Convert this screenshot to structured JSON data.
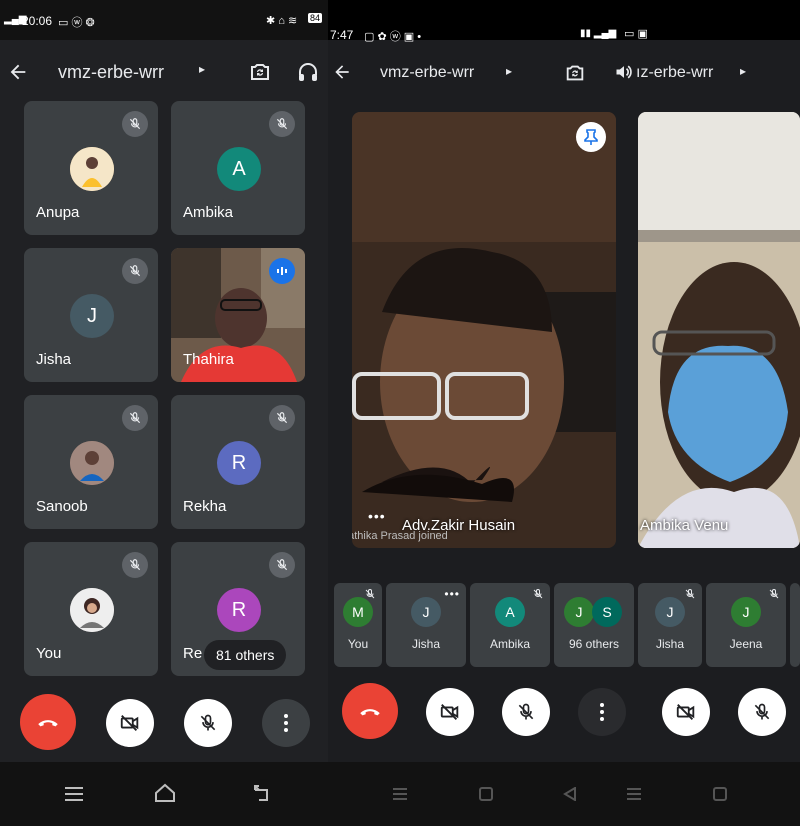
{
  "left": {
    "status": {
      "time": "20:06",
      "battery": "84"
    },
    "meeting_code": "vmz-erbe-wrr",
    "participants": [
      {
        "name": "Anupa",
        "initial": "",
        "color": "#f1c27d",
        "muted": true,
        "kind": "photo"
      },
      {
        "name": "Ambika",
        "initial": "A",
        "color": "#12897a",
        "muted": true,
        "kind": "letter"
      },
      {
        "name": "Jisha",
        "initial": "J",
        "color": "#455a64",
        "muted": true,
        "kind": "letter"
      },
      {
        "name": "Thahira",
        "initial": "",
        "color": "",
        "muted": false,
        "kind": "video"
      },
      {
        "name": "Sanoob",
        "initial": "",
        "color": "#8d6e63",
        "muted": true,
        "kind": "photo"
      },
      {
        "name": "Rekha",
        "initial": "R",
        "color": "#5c6bc0",
        "muted": true,
        "kind": "letter"
      },
      {
        "name": "You",
        "initial": "",
        "color": "#d7ccc8",
        "muted": true,
        "kind": "photo"
      },
      {
        "name": "Re",
        "initial": "R",
        "color": "#ab47bc",
        "muted": true,
        "kind": "letter"
      }
    ],
    "others_label": "81 others"
  },
  "right": {
    "status": {
      "time": "7:47"
    },
    "meeting_code": "vmz-erbe-wrr",
    "meeting_code_partial": "ız-erbe-wrr",
    "speaker_main": "Adv.Zakir Husain",
    "join_toast": "Lathika Prasad joined",
    "speaker_second": "Ambika Venu",
    "strip": [
      {
        "name": "You",
        "initial": "M",
        "color": "#2e7d32",
        "muted": true
      },
      {
        "name": "Jisha",
        "initial": "J",
        "color": "#455a64",
        "muted": false,
        "menu": true
      },
      {
        "name": "Ambika",
        "initial": "A",
        "color": "#12897a",
        "muted": true
      },
      {
        "name": "96 others",
        "initial": "J",
        "initial2": "S",
        "color": "#2e7d32",
        "color2": "#00695c",
        "muted": false
      },
      {
        "name": "Jisha",
        "initial": "J",
        "color": "#455a64",
        "muted": true
      },
      {
        "name": "Jeena",
        "initial": "J",
        "color": "#2e7d32",
        "muted": true
      }
    ]
  },
  "colors": {
    "end_call": "#ea4335",
    "tile_bg": "#3c4043",
    "panel_bg": "#202124"
  }
}
